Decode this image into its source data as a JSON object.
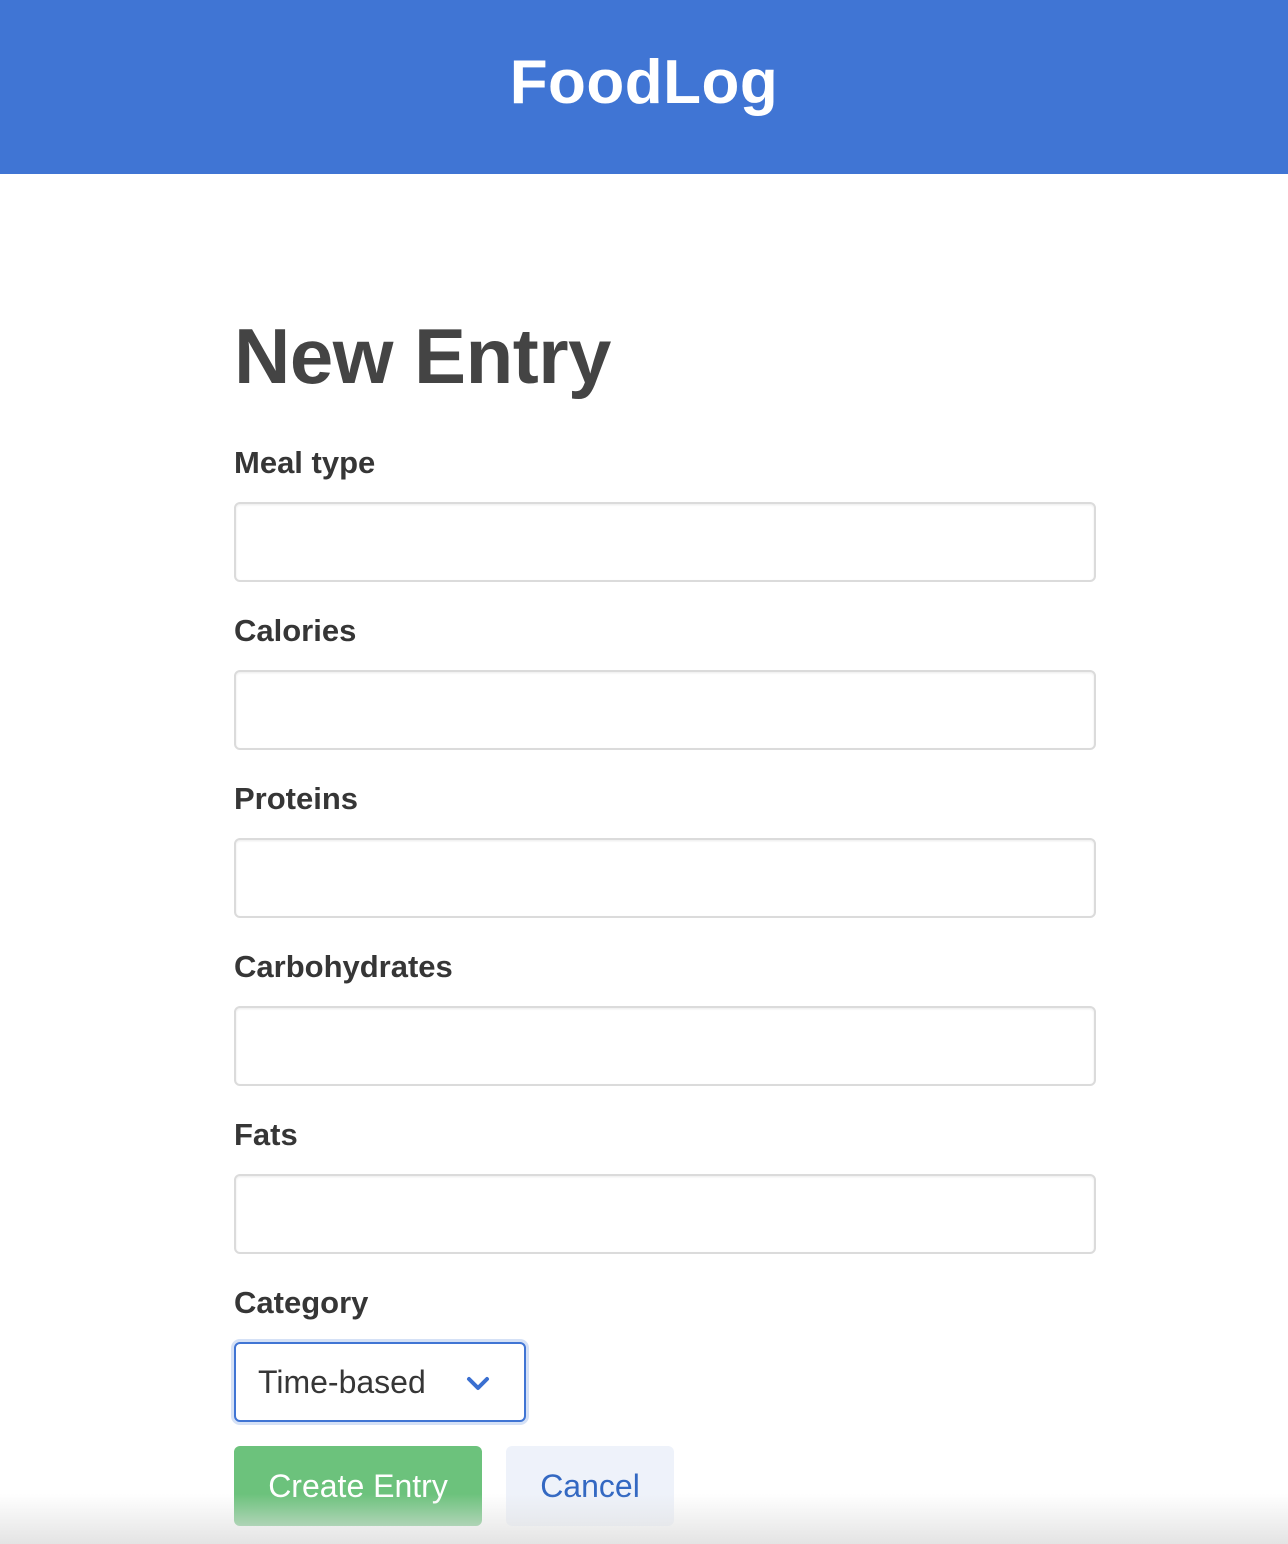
{
  "header": {
    "brand": "FoodLog",
    "brand_color": "#4075d4"
  },
  "page": {
    "title": "New Entry"
  },
  "form": {
    "meal_type": {
      "label": "Meal type",
      "value": "",
      "placeholder": ""
    },
    "calories": {
      "label": "Calories",
      "value": "",
      "placeholder": ""
    },
    "proteins": {
      "label": "Proteins",
      "value": "",
      "placeholder": ""
    },
    "carbohydrates": {
      "label": "Carbohydrates",
      "value": "",
      "placeholder": ""
    },
    "fats": {
      "label": "Fats",
      "value": "",
      "placeholder": ""
    },
    "category": {
      "label": "Category",
      "selected": "Time-based",
      "icon": "chevron-down-icon"
    }
  },
  "actions": {
    "create_label": "Create Entry",
    "cancel_label": "Cancel",
    "create_color": "#6cc27c",
    "cancel_color": "#3368c2"
  }
}
